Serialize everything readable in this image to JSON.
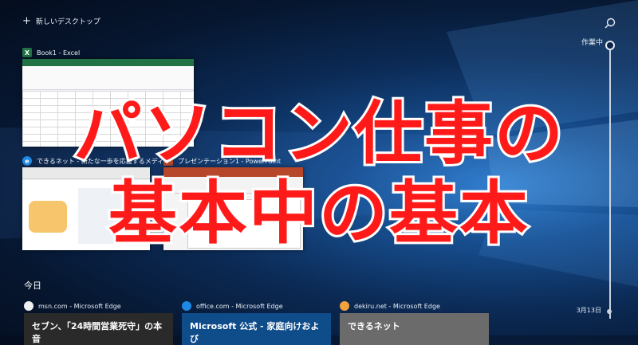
{
  "topbar": {
    "new_desktop": "新しいデスクトップ"
  },
  "timeline": {
    "now_label": "作業中",
    "date_label": "3月13日"
  },
  "windows": [
    {
      "title": "Book1 - Excel",
      "app": "excel"
    },
    {
      "title": "できるネット - 新たな一歩を応援するメディ...",
      "app": "edge"
    },
    {
      "title": "プレゼンテーション1 - PowerPoint",
      "app": "powerpoint"
    }
  ],
  "overlay": {
    "line1": "パソコン仕事の",
    "line2": "基本中の基本"
  },
  "today": {
    "label": "今日"
  },
  "activities": [
    {
      "source": "msn.com - Microsoft Edge",
      "title": "セブン、「24時間営業死守」の本音",
      "color": "#2a2a2a"
    },
    {
      "source": "office.com - Microsoft Edge",
      "title": "Microsoft 公式 - 家庭向けおよび",
      "color": "#0f4c8a"
    },
    {
      "source": "dekiru.net - Microsoft Edge",
      "title": "できるネット",
      "color": "#6b6b6b"
    }
  ],
  "colors": {
    "overlay_text": "#ff1a1a",
    "overlay_stroke": "#ffffff",
    "excel": "#217346",
    "powerpoint": "#b7472a",
    "edge": "#1e88e5"
  }
}
